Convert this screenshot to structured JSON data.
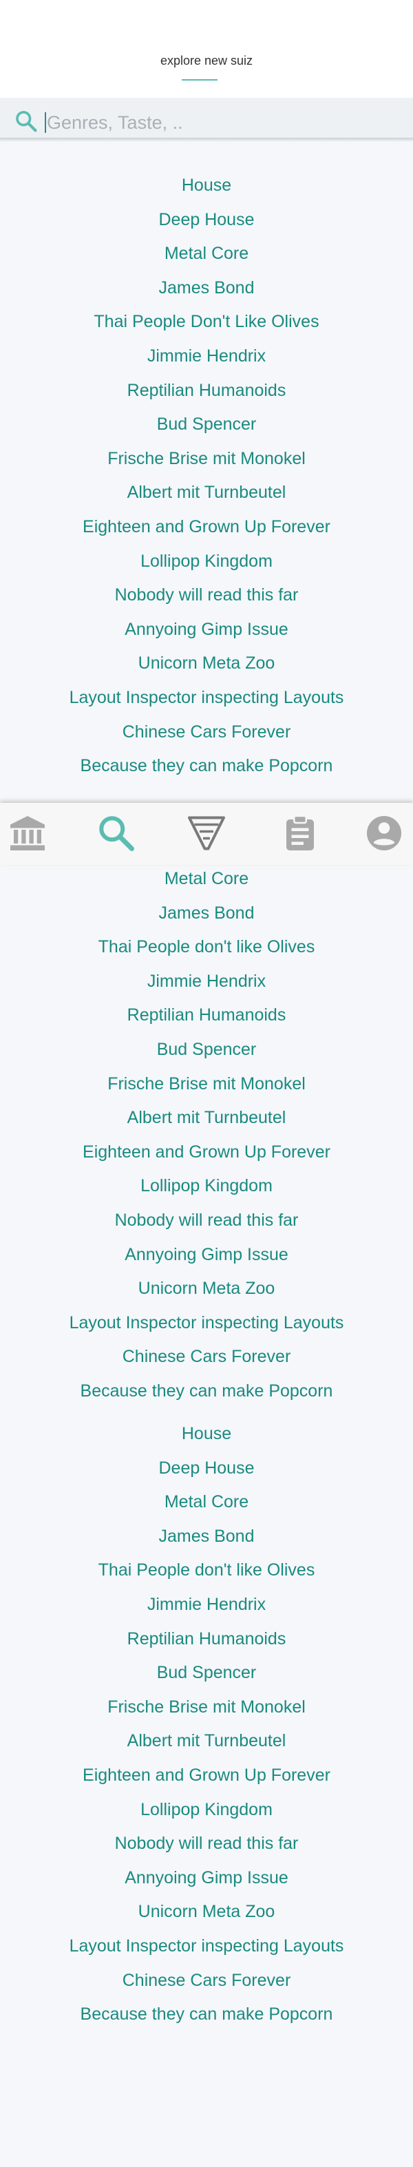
{
  "header": {
    "title": "explore new suiz"
  },
  "search": {
    "placeholder": "Genres, Taste, ..",
    "value": ""
  },
  "icons": {
    "search": "search-icon",
    "nav_home": "bank-icon",
    "nav_search": "search-icon",
    "nav_filter": "funnel-icon",
    "nav_clipboard": "clipboard-icon",
    "nav_profile": "account-icon"
  },
  "colors": {
    "accent": "#5bbcb1",
    "list_text": "#1a8a80",
    "nav_inactive": "#a9a9a9",
    "background": "#f5f7fa"
  },
  "lists": {
    "main": [
      "House",
      "Deep House",
      "Metal Core",
      "James Bond",
      "Thai People Don't Like Olives",
      "Jimmie Hendrix",
      "Reptilian Humanoids",
      "Bud Spencer",
      "Frische Brise mit Monokel",
      "Albert mit Turnbeutel",
      "Eighteen and Grown Up Forever",
      "Lollipop Kingdom",
      "Nobody will read this far",
      "Annyoing Gimp Issue",
      "Unicorn Meta Zoo",
      "Layout Inspector inspecting Layouts",
      "Chinese Cars Forever",
      "Because they can make Popcorn"
    ],
    "second": [
      "Metal Core",
      "James Bond",
      "Thai People don't like Olives",
      "Jimmie Hendrix",
      "Reptilian Humanoids",
      "Bud Spencer",
      "Frische Brise mit Monokel",
      "Albert mit Turnbeutel",
      "Eighteen and Grown Up Forever",
      "Lollipop Kingdom",
      "Nobody will read this far",
      "Annyoing Gimp Issue",
      "Unicorn Meta Zoo",
      "Layout Inspector inspecting Layouts",
      "Chinese Cars Forever",
      "Because they can make Popcorn"
    ],
    "third": [
      "House",
      "Deep House",
      "Metal Core",
      "James Bond",
      "Thai People don't like Olives",
      "Jimmie Hendrix",
      "Reptilian Humanoids",
      "Bud Spencer",
      "Frische Brise mit Monokel",
      "Albert mit Turnbeutel",
      "Eighteen and Grown Up Forever",
      "Lollipop Kingdom",
      "Nobody will read this far",
      "Annyoing Gimp Issue",
      "Unicorn Meta Zoo",
      "Layout Inspector inspecting Layouts",
      "Chinese Cars Forever",
      "Because they can make Popcorn"
    ]
  }
}
